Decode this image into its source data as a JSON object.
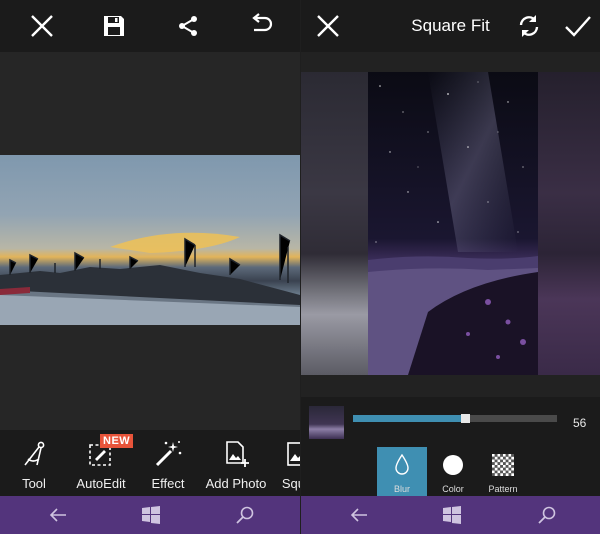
{
  "left_screen": {
    "toolbar_items": [
      {
        "label": "Tool",
        "icon": "compass-icon"
      },
      {
        "label": "AutoEdit",
        "icon": "auto-edit-icon",
        "badge": "NEW"
      },
      {
        "label": "Effect",
        "icon": "magic-wand-icon"
      },
      {
        "label": "Add Photo",
        "icon": "add-photo-icon"
      },
      {
        "label": "Squa",
        "icon": "square-fit-icon"
      }
    ]
  },
  "right_screen": {
    "title": "Square Fit",
    "slider": {
      "value": "56",
      "fraction": 0.56
    },
    "options": [
      {
        "label": "Blur",
        "icon": "drop-icon",
        "selected": true
      },
      {
        "label": "Color",
        "icon": "circle-icon",
        "selected": false
      },
      {
        "label": "Pattern",
        "icon": "checkerboard-icon",
        "selected": false
      }
    ]
  },
  "colors": {
    "accent": "#3f8fb2",
    "navbar": "#53347c",
    "badge": "#e8543a"
  }
}
